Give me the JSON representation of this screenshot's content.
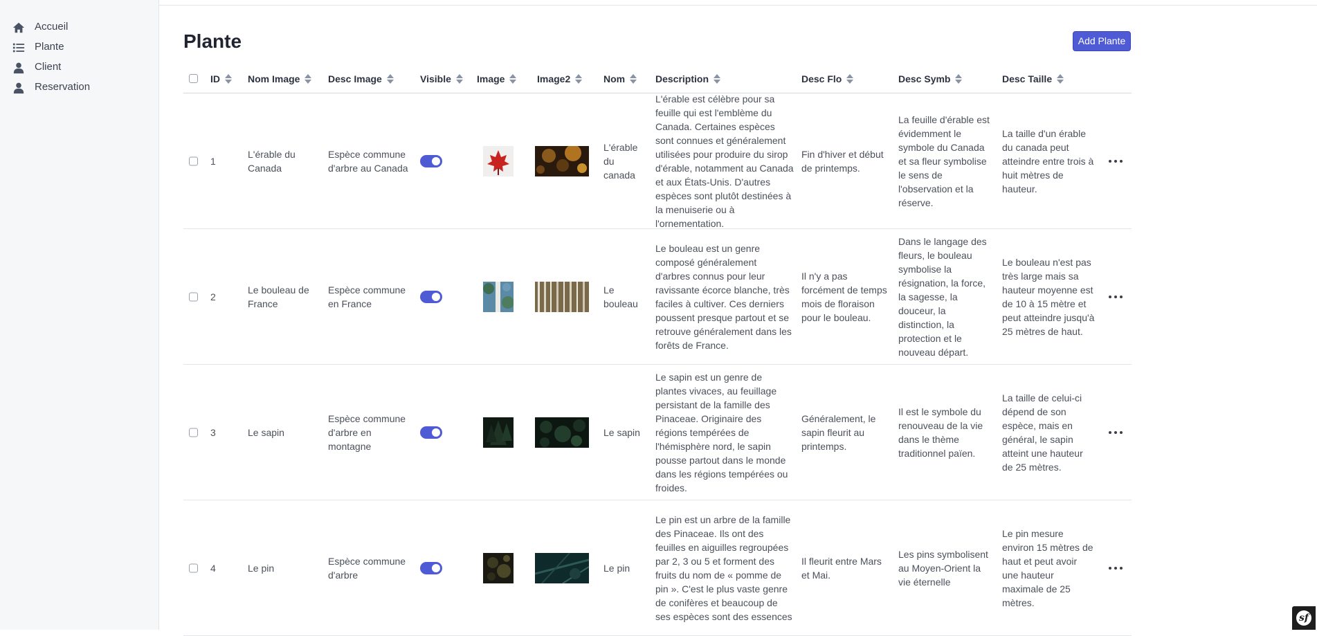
{
  "sidebar": {
    "items": [
      {
        "label": "Accueil",
        "icon": "home-icon"
      },
      {
        "label": "Plante",
        "icon": "list-icon"
      },
      {
        "label": "Client",
        "icon": "user-icon"
      },
      {
        "label": "Reservation",
        "icon": "user-icon"
      }
    ]
  },
  "page": {
    "title": "Plante",
    "add_button": "Add Plante"
  },
  "colors": {
    "accent": "#4f5bd5",
    "sidebar_bg": "#f6f7f9"
  },
  "table": {
    "headers": {
      "id": "ID",
      "nom_image": "Nom Image",
      "desc_image": "Desc Image",
      "visible": "Visible",
      "image": "Image",
      "image2": "Image2",
      "nom": "Nom",
      "description": "Description",
      "desc_flo": "Desc Flo",
      "desc_symb": "Desc Symb",
      "desc_taille": "Desc Taille"
    },
    "rows": [
      {
        "id": "1",
        "nom_image": "L'érable du Canada",
        "desc_image": "Espèce commune d'arbre au Canada",
        "visible": true,
        "nom": "L'érable du canada",
        "description": "L'érable est célèbre pour sa feuille qui est l'emblème du Canada. Certaines espèces sont connues et généralement utilisées pour produire du sirop d'érable, notamment au Canada et aux États-Unis. D'autres espèces sont plutôt destinées à la menuiserie ou à l'ornementation.",
        "desc_flo": "Fin d'hiver et début de printemps.",
        "desc_symb": "La feuille d'érable est évidemment le symbole du Canada et sa fleur symbolise le sens de l'observation et la réserve.",
        "desc_taille": "La taille d'un érable du canada peut atteindre entre trois à huit mètres de hauteur."
      },
      {
        "id": "2",
        "nom_image": "Le bouleau de France",
        "desc_image": "Espèce commune en France",
        "visible": true,
        "nom": "Le bouleau",
        "description": "Le bouleau est un genre composé généralement d'arbres connus pour leur ravissante écorce blanche, très faciles à cultiver. Ces derniers poussent presque partout et se retrouve généralement dans les forêts de France.",
        "desc_flo": "Il n'y a pas forcément de temps mois de floraison pour le bouleau.",
        "desc_symb": "Dans le langage des fleurs, le bouleau symbolise la résignation, la force, la sagesse, la douceur, la distinction, la protection et le nouveau départ.",
        "desc_taille": "Le bouleau n'est pas très large mais sa hauteur moyenne est de 10 à 15 mètre et peut atteindre jusqu'à 25 mètres de haut."
      },
      {
        "id": "3",
        "nom_image": "Le sapin",
        "desc_image": "Espèce commune d'arbre en montagne",
        "visible": true,
        "nom": "Le sapin",
        "description": "Le sapin est un genre de plantes vivaces, au feuillage persistant de la famille des Pinaceae. Originaire des régions tempérées de l'hémisphère nord, le sapin pousse partout dans le monde dans les régions tempérées ou froides.",
        "desc_flo": "Généralement, le sapin fleurit au printemps.",
        "desc_symb": "Il est le symbole du renouveau de la vie dans le thème traditionnel païen.",
        "desc_taille": "La taille de celui-ci dépend de son espèce, mais en général, le sapin atteint une hauteur de 25 mètres."
      },
      {
        "id": "4",
        "nom_image": "Le pin",
        "desc_image": "Espèce commune d'arbre",
        "visible": true,
        "nom": "Le pin",
        "description": "Le pin est un arbre de la famille des Pinaceae. Ils ont des feuilles en aiguilles regroupées par 2, 3 ou 5 et forment des fruits du nom de « pomme de pin ». C'est le plus vaste genre de conifères et beaucoup de ses espèces sont des essences",
        "desc_flo": "Il fleurit entre Mars et Mai.",
        "desc_symb": "Les pins symbolisent au Moyen-Orient la vie éternelle",
        "desc_taille": "Le pin mesure environ 15 mètres de haut et peut avoir une hauteur maximale de 25 mètres."
      }
    ]
  },
  "footer": {
    "debug_badge": "sf"
  }
}
